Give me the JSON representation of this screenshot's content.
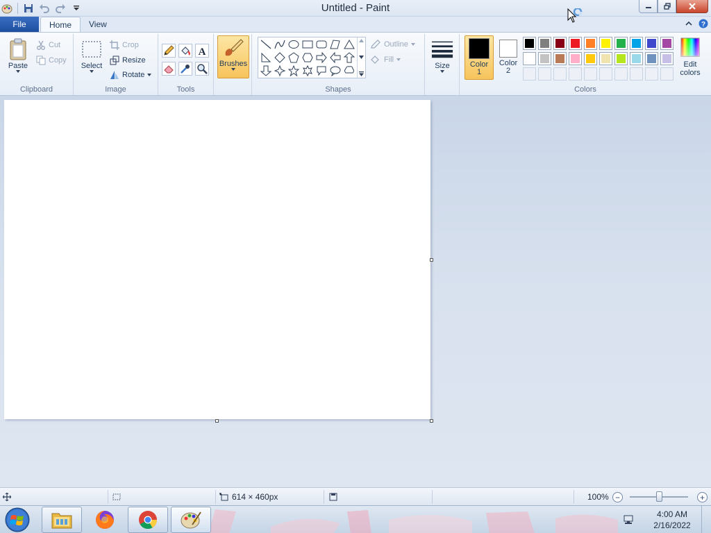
{
  "window": {
    "title": "Untitled - Paint"
  },
  "ribbon_tabs": {
    "file": "File",
    "home": "Home",
    "view": "View"
  },
  "clipboard": {
    "group": "Clipboard",
    "paste": "Paste",
    "cut": "Cut",
    "copy": "Copy"
  },
  "image": {
    "group": "Image",
    "select": "Select",
    "crop": "Crop",
    "resize": "Resize",
    "rotate": "Rotate"
  },
  "tools": {
    "group": "Tools"
  },
  "brushes": {
    "label": "Brushes"
  },
  "shapes": {
    "group": "Shapes",
    "outline": "Outline",
    "fill": "Fill"
  },
  "size": {
    "label": "Size"
  },
  "colors": {
    "group": "Colors",
    "color1_line1": "Color",
    "color1_line2": "1",
    "color2_line1": "Color",
    "color2_line2": "2",
    "edit_line1": "Edit",
    "edit_line2": "colors",
    "color1_value": "#000000",
    "color2_value": "#ffffff",
    "palette": [
      [
        "#000000",
        "#7f7f7f",
        "#880015",
        "#ed1c24",
        "#ff7f27",
        "#fff200",
        "#22b14c",
        "#00a2e8",
        "#3f48cc",
        "#a349a4"
      ],
      [
        "#ffffff",
        "#c3c3c3",
        "#b97a57",
        "#ffaec9",
        "#ffc90e",
        "#efe4b0",
        "#b5e61d",
        "#99d9ea",
        "#7092be",
        "#c8bfe7"
      ]
    ]
  },
  "statusbar": {
    "canvas_size": "614 × 460px",
    "zoom": "100%"
  },
  "taskbar": {
    "time": "4:00 AM",
    "date": "2/16/2022"
  }
}
